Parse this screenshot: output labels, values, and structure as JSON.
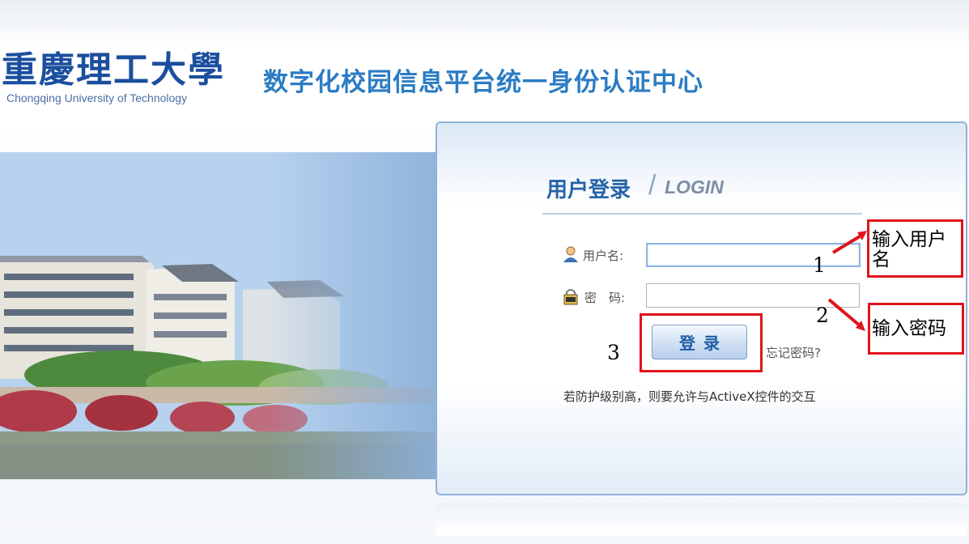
{
  "header": {
    "logo_cn": "重慶理工大學",
    "logo_en": "Chongqing University of Technology",
    "site_title": "数字化校园信息平台统一身份认证中心"
  },
  "login": {
    "title_cn": "用户登录",
    "title_slash": "/",
    "title_en": "LOGIN",
    "username_label": "用户名:",
    "username_value": "",
    "password_label": "密　码:",
    "password_value": "",
    "submit_label": "登录",
    "forgot_label": "忘记密码?",
    "activex_notice": "若防护级别高，则要允许与ActiveX控件的交互"
  },
  "annotations": {
    "step1_number": "1",
    "step1_text": "输入用户名",
    "step2_number": "2",
    "step2_text": "输入密码",
    "step3_number": "3",
    "box_color": "#e0141c"
  },
  "icons": [
    "user-icon",
    "lock-icon",
    "arrow-icon"
  ]
}
